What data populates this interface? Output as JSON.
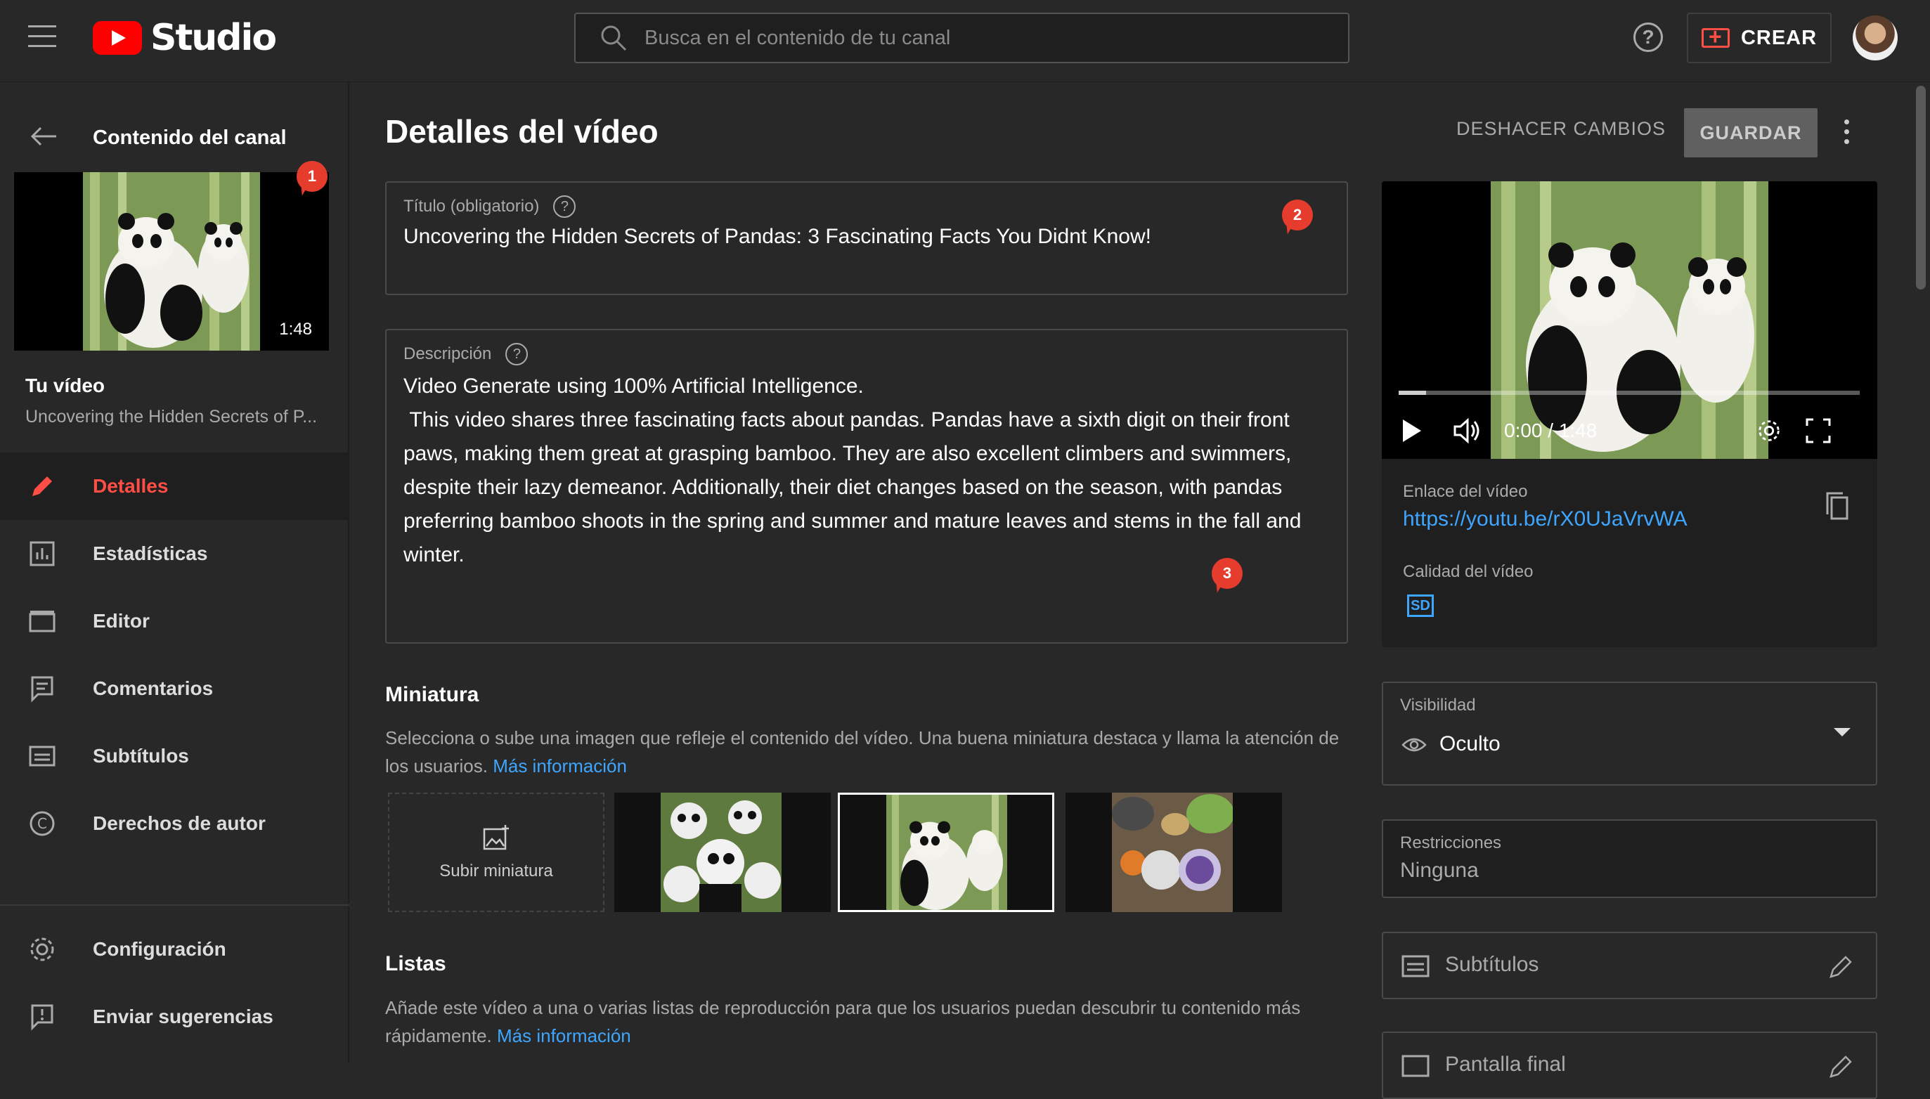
{
  "topbar": {
    "logo_text": "Studio",
    "search_placeholder": "Busca en el contenido de tu canal",
    "help_label": "?",
    "create_label": "CREAR"
  },
  "sidebar": {
    "back_label": "Contenido del canal",
    "thumb_duration": "1:48",
    "badge": "1",
    "your_video_label": "Tu vídeo",
    "your_video_title": "Uncovering the Hidden Secrets of P...",
    "items": [
      {
        "label": "Detalles",
        "icon": "pencil-icon",
        "active": true
      },
      {
        "label": "Estadísticas",
        "icon": "analytics-icon"
      },
      {
        "label": "Editor",
        "icon": "clapperboard-icon"
      },
      {
        "label": "Comentarios",
        "icon": "comments-icon"
      },
      {
        "label": "Subtítulos",
        "icon": "subtitles-icon"
      },
      {
        "label": "Derechos de autor",
        "icon": "copyright-icon"
      }
    ],
    "bottom_items": [
      {
        "label": "Configuración",
        "icon": "gear-icon"
      },
      {
        "label": "Enviar sugerencias",
        "icon": "feedback-icon"
      }
    ]
  },
  "main": {
    "title": "Detalles del vídeo",
    "undo_label": "DESHACER CAMBIOS",
    "save_label": "GUARDAR",
    "title_field": {
      "label": "Título (obligatorio)",
      "value": "Uncovering the Hidden Secrets of Pandas: 3 Fascinating Facts You Didnt Know!",
      "badge": "2"
    },
    "description_field": {
      "label": "Descripción",
      "value": "Video Generate using 100% Artificial Intelligence.\n This video shares three fascinating facts about pandas. Pandas have a sixth digit on their front paws, making them great at grasping bamboo. They are also excellent climbers and swimmers, despite their lazy demeanor. Additionally, their diet changes based on the season, with pandas preferring bamboo shoots in the spring and summer and mature leaves and stems in the fall and winter.",
      "badge": "3"
    },
    "thumbnail": {
      "title": "Miniatura",
      "desc": "Selecciona o sube una imagen que refleje el contenido del vídeo. Una buena miniatura destaca y llama la atención de los usuarios.",
      "link": "Más información",
      "upload_label": "Subir miniatura"
    },
    "playlists": {
      "title": "Listas",
      "desc": "Añade este vídeo a una o varias listas de reproducción para que los usuarios puedan descubrir tu contenido más rápidamente.",
      "link": "Más información"
    }
  },
  "right": {
    "time": "0:00 / 1:48",
    "progress": 0.06,
    "link_label": "Enlace del vídeo",
    "link_value": "https://youtu.be/rX0UJaVrvWA",
    "quality_label": "Calidad del vídeo",
    "quality_badge": "SD",
    "visibility_label": "Visibilidad",
    "visibility_value": "Oculto",
    "restrictions_label": "Restricciones",
    "restrictions_value": "Ninguna",
    "subtitles_label": "Subtítulos",
    "end_screen_label": "Pantalla final"
  },
  "colors": {
    "accent": "#ff4e45",
    "link": "#3ea6ff",
    "background": "#282828"
  }
}
